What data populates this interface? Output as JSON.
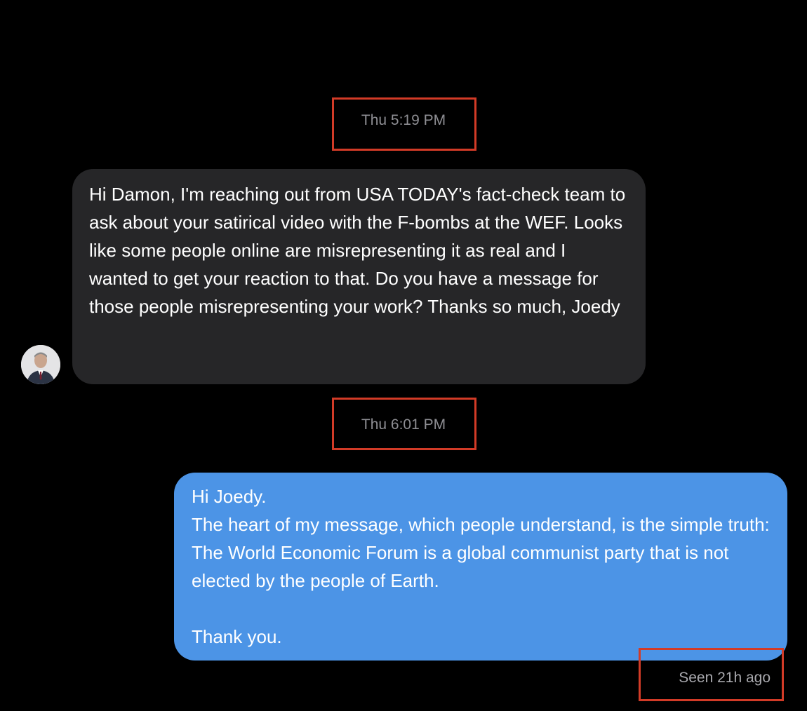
{
  "conversation": {
    "timestamp_1": "Thu 5:19 PM",
    "timestamp_2": "Thu 6:01 PM",
    "incoming_message": "Hi Damon, I'm reaching out from USA TODAY's fact-check team to ask about your satirical video with the F-bombs at the WEF. Looks like some people online are misrepresenting it as real and I wanted to get your reaction to that. Do you have a message for those people misrepresenting your work? Thanks so much, Joedy",
    "outgoing_message": "Hi Joedy.\nThe heart of my message, which people understand, is the simple truth: The World Economic Forum is a global communist party that is not elected by the people of Earth.\n\nThank you.",
    "seen_status": "Seen 21h ago",
    "sender_avatar_icon": "person-avatar-icon"
  },
  "colors": {
    "background": "#000000",
    "incoming_bubble": "#262628",
    "outgoing_bubble": "#4c94e6",
    "highlight_box": "#d23b27",
    "timestamp_text": "#8e8e93"
  }
}
